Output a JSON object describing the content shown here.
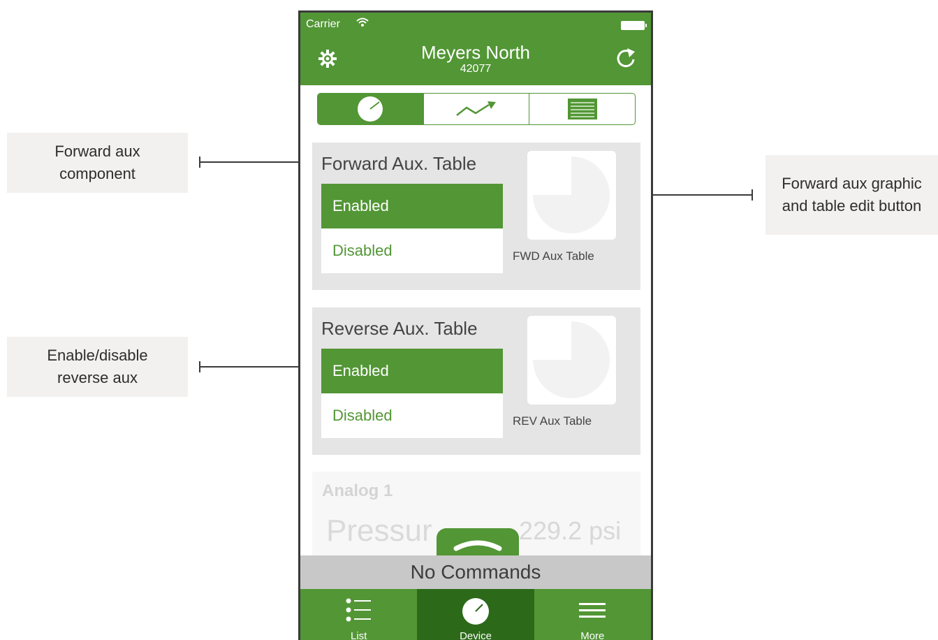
{
  "callouts": {
    "forward": "Forward aux component",
    "reverse": "Enable/disable reverse aux",
    "graphic": "Forward aux graphic and table edit button"
  },
  "status_bar": {
    "carrier": "Carrier"
  },
  "header": {
    "title": "Meyers North",
    "subtitle": "42077"
  },
  "segments": [
    {
      "icon": "gauge-icon",
      "selected": true
    },
    {
      "icon": "trend-chart-icon",
      "selected": false
    },
    {
      "icon": "table-icon",
      "selected": false
    }
  ],
  "forward_card": {
    "title": "Forward Aux. Table",
    "enabled_label": "Enabled",
    "disabled_label": "Disabled",
    "graphic_label": "FWD Aux Table",
    "graphic_fill": 0.75
  },
  "reverse_card": {
    "title": "Reverse Aux. Table",
    "enabled_label": "Enabled",
    "disabled_label": "Disabled",
    "graphic_label": "REV Aux Table",
    "graphic_fill": 0.75
  },
  "analog_card": {
    "title": "Analog 1",
    "value_label": "Pressur",
    "reading": "229.2 psi"
  },
  "commands": {
    "label": "No Commands"
  },
  "tabbar": {
    "items": [
      {
        "label": "List",
        "icon": "list-icon",
        "active": false
      },
      {
        "label": "Device",
        "icon": "gauge-icon",
        "active": true
      },
      {
        "label": "More",
        "icon": "menu-icon",
        "active": false
      }
    ]
  },
  "colors": {
    "accent": "#529635",
    "accent_dark": "#2c6a1a",
    "card_bg": "#e5e5e5"
  }
}
